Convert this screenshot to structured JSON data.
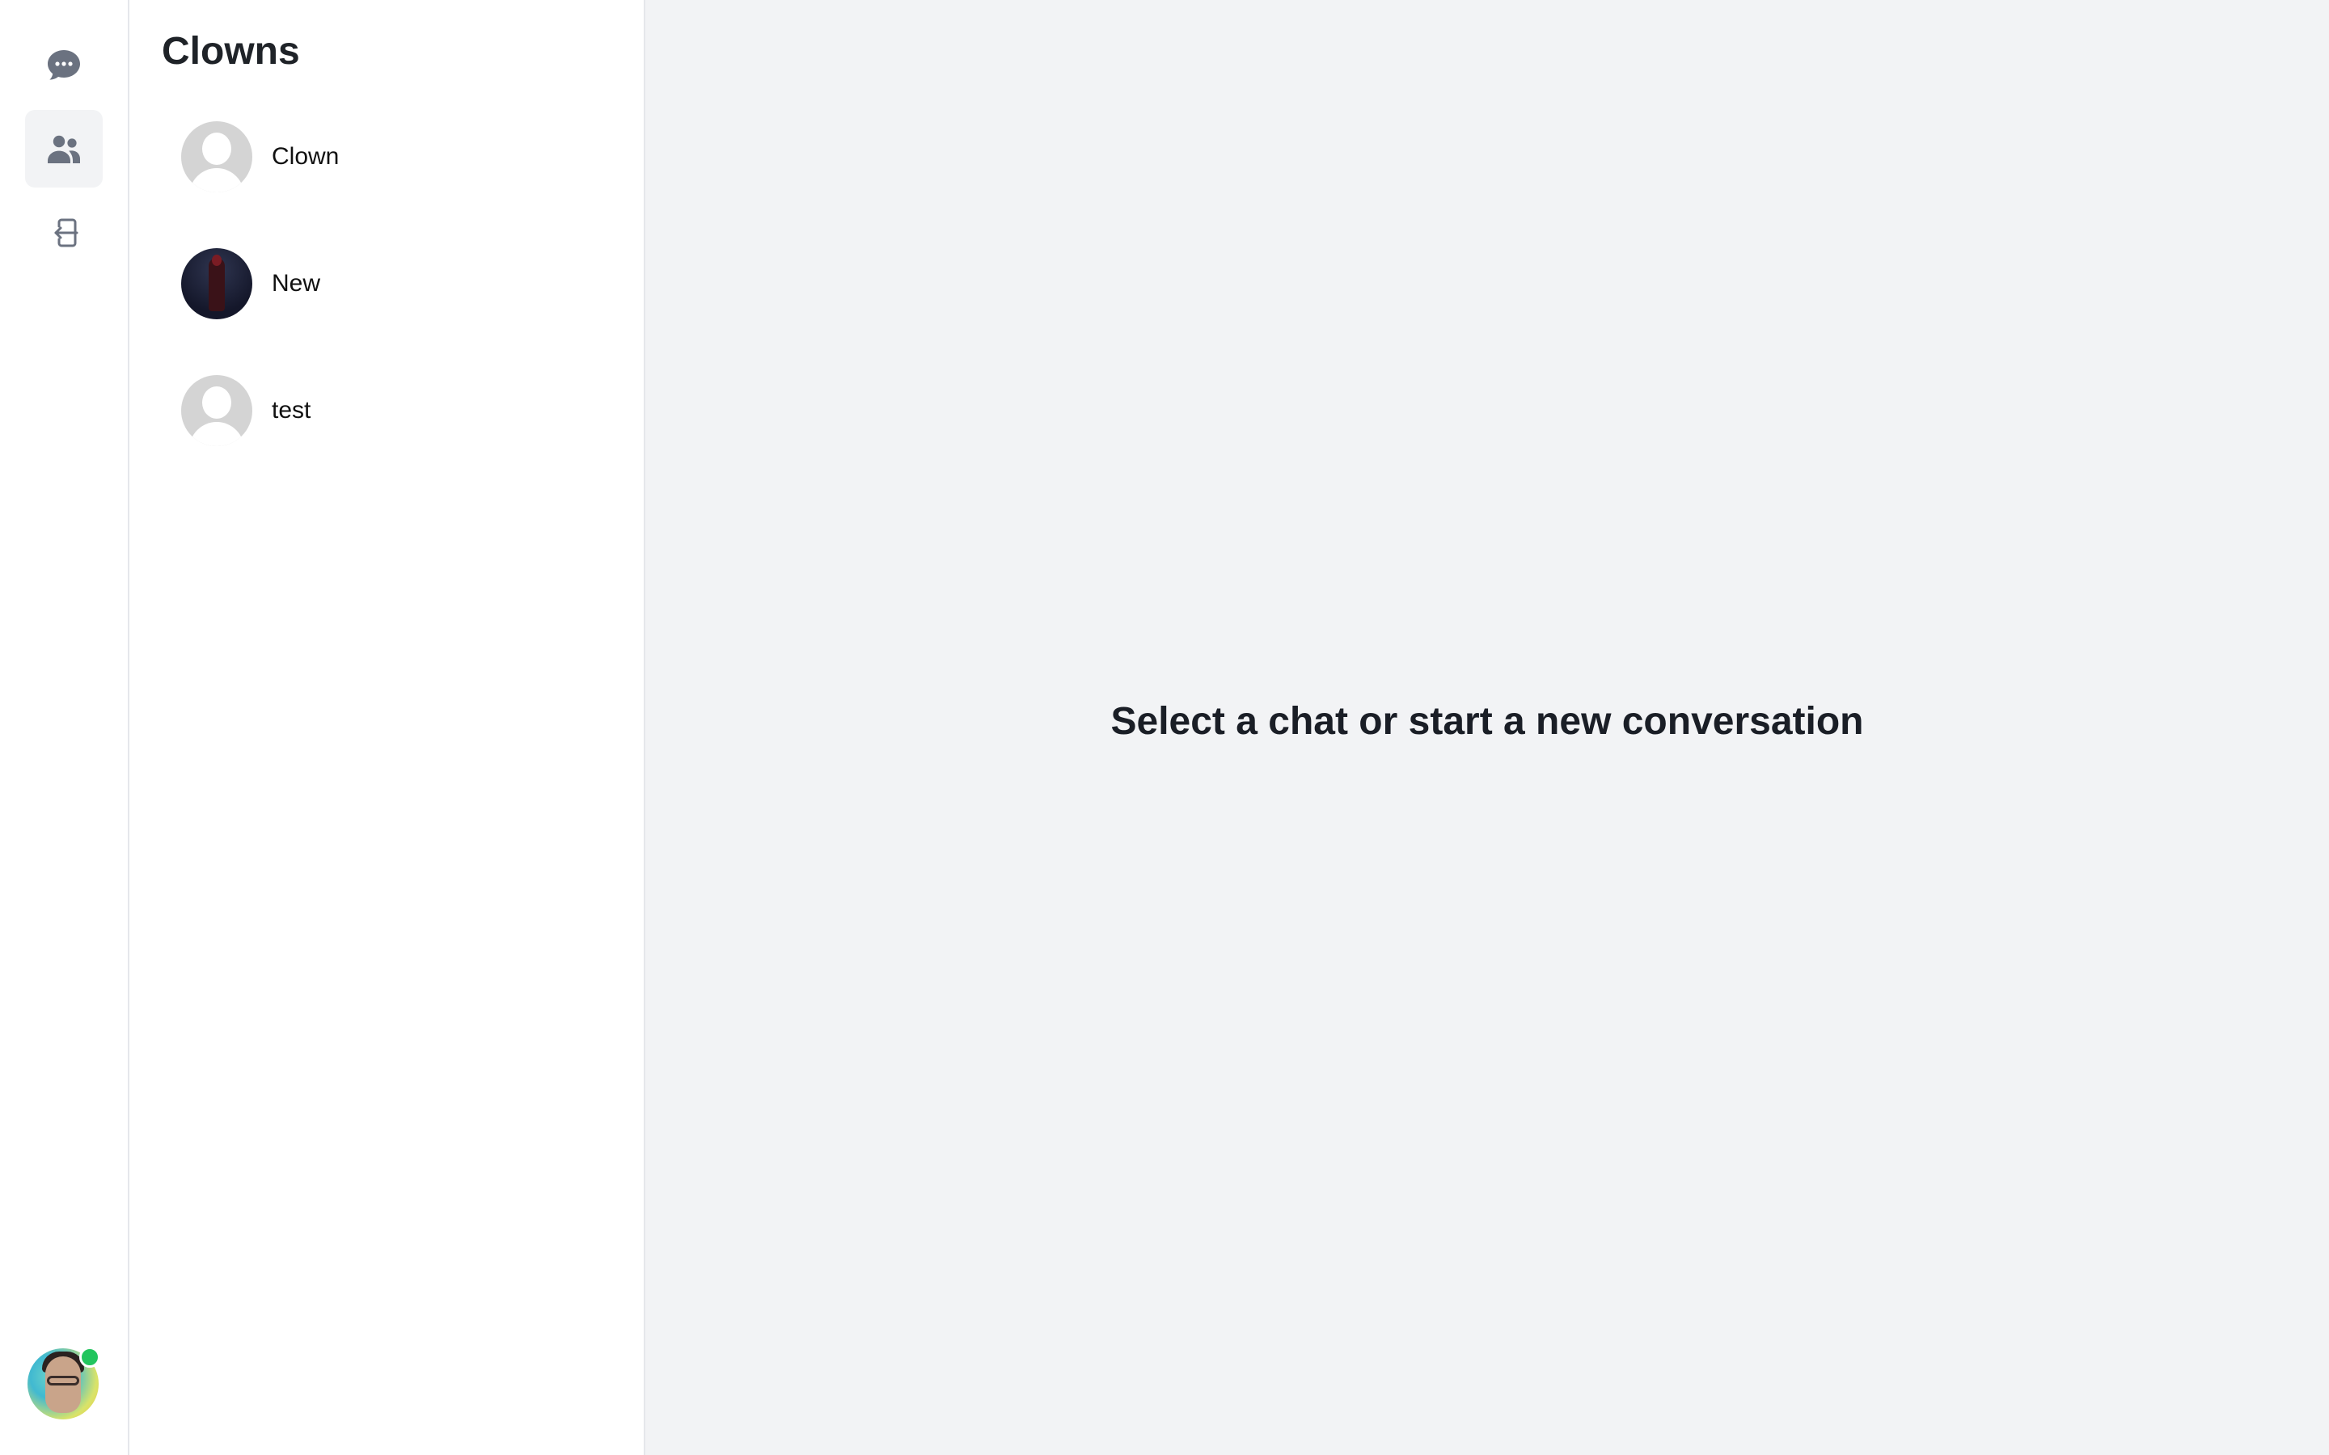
{
  "rail": {
    "items": [
      {
        "icon": "chat-bubble-icon",
        "active": false
      },
      {
        "icon": "users-icon",
        "active": true
      },
      {
        "icon": "logout-icon",
        "active": false
      }
    ],
    "status": "online"
  },
  "panel": {
    "title": "Clowns",
    "contacts": [
      {
        "name": "Clown",
        "avatar": "placeholder"
      },
      {
        "name": "New",
        "avatar": "photo"
      },
      {
        "name": "test",
        "avatar": "placeholder"
      }
    ]
  },
  "main": {
    "empty_message": "Select a chat or start a new conversation"
  },
  "colors": {
    "rail_bg": "#ffffff",
    "main_bg": "#f2f3f5",
    "active_item_bg": "#f2f3f5",
    "icon": "#6b7280",
    "online": "#22c55e"
  }
}
